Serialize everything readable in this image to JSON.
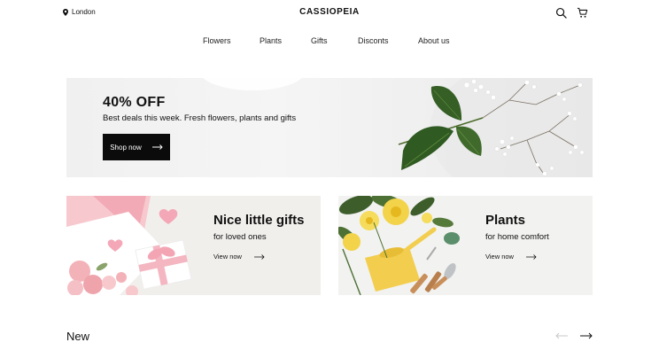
{
  "header": {
    "location": "London",
    "brand": "CASSIOPEIA",
    "icons": [
      "map-pin-icon",
      "search-icon",
      "cart-icon"
    ]
  },
  "nav": {
    "items": [
      "Flowers",
      "Plants",
      "Gifts",
      "Disconts",
      "About us"
    ]
  },
  "hero": {
    "title": "40% OFF",
    "subtitle": "Best deals this week. Fresh flowers, plants and gifts",
    "button_label": "Shop now"
  },
  "cards": [
    {
      "title": "Nice little gifts",
      "subtitle": "for loved ones",
      "link": "View now"
    },
    {
      "title": "Plants",
      "subtitle": "for home comfort",
      "link": "View now"
    }
  ],
  "section": {
    "title": "New"
  },
  "colors": {
    "button_bg": "#0b0b0b",
    "text": "#111111",
    "leaf_green": "#2f5a22",
    "pink": "#f4b6c1",
    "yellow": "#f2d34a"
  }
}
